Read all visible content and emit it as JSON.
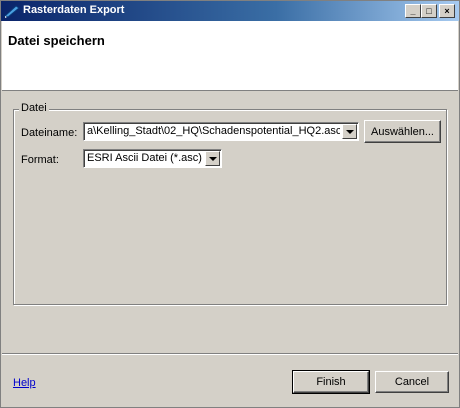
{
  "window": {
    "title": "Rasterdaten Export",
    "app_icon": "pen-icon",
    "controls": {
      "minimize": "_",
      "maximize": "□",
      "close": "×"
    }
  },
  "header": {
    "title": "Datei speichern"
  },
  "group": {
    "legend": "Datei",
    "filename_label": "Dateiname:",
    "filename_value": "a\\Kelling_Stadt\\02_HQ\\Schadenspotential_HQ2.asc",
    "choose_button": "Auswählen...",
    "format_label": "Format:",
    "format_value": "ESRI Ascii Datei (*.asc)"
  },
  "footer": {
    "help_link": "Help",
    "finish_button": "Finish",
    "cancel_button": "Cancel"
  },
  "colors": {
    "titlebar_start": "#0a246a",
    "titlebar_end": "#a6caf0",
    "dialog_bg": "#d4d0c8",
    "link": "#0000cc"
  }
}
